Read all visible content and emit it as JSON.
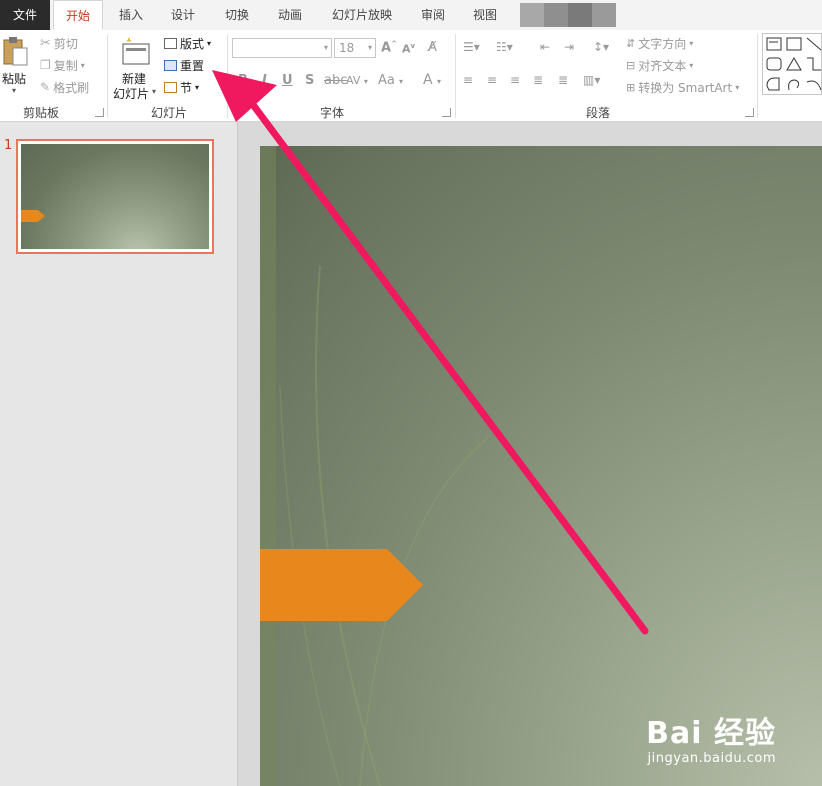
{
  "tabs": [
    {
      "label": "文件"
    },
    {
      "label": "开始"
    },
    {
      "label": "插入"
    },
    {
      "label": "设计"
    },
    {
      "label": "切换"
    },
    {
      "label": "动画"
    },
    {
      "label": "幻灯片放映"
    },
    {
      "label": "审阅"
    },
    {
      "label": "视图"
    }
  ],
  "clipboard": {
    "paste": "粘贴",
    "cut": "剪切",
    "copy": "复制",
    "format_painter": "格式刷",
    "group": "剪贴板"
  },
  "slides_group": {
    "new_slide_line1": "新建",
    "new_slide_line2": "幻灯片",
    "layout": "版式",
    "reset": "重置",
    "section": "节",
    "group": "幻灯片"
  },
  "font": {
    "size": "18",
    "bold": "B",
    "italic": "I",
    "underline": "U",
    "shadow": "S",
    "spacing": "AV",
    "case": "Aa",
    "color": "A",
    "group": "字体"
  },
  "paragraph": {
    "text_direction": "文字方向",
    "align_text": "对齐文本",
    "smartart": "转换为 SmartArt",
    "group": "段落"
  },
  "slide_pane": {
    "number": "1"
  },
  "watermark": {
    "brand": "Bai 经验",
    "url": "jingyan.baidu.com"
  },
  "colors": {
    "accent": "#c43e1c",
    "arrow": "#f0195f",
    "shape_orange": "#e8871b"
  }
}
